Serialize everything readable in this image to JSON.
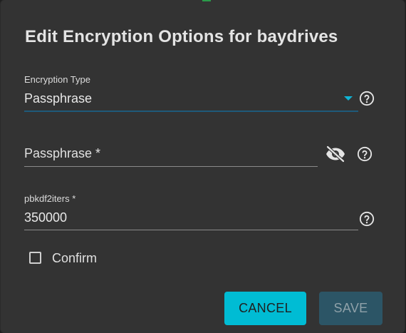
{
  "dialog": {
    "title": "Edit Encryption Options for baydrives"
  },
  "encryption_type": {
    "label": "Encryption Type",
    "value": "Passphrase"
  },
  "passphrase": {
    "placeholder": "Passphrase *"
  },
  "pbkdf2iters": {
    "label": "pbkdf2iters *",
    "value": "350000"
  },
  "confirm": {
    "label": "Confirm",
    "checked": false
  },
  "actions": {
    "cancel_label": "CANCEL",
    "save_label": "SAVE"
  },
  "colors": {
    "accent": "#00bcd4",
    "dialog_bg": "#333333",
    "save_disabled": "#2c5566"
  },
  "icons": [
    "help-icon",
    "visibility-off-icon",
    "dropdown-arrow-icon",
    "checkbox-icon"
  ]
}
